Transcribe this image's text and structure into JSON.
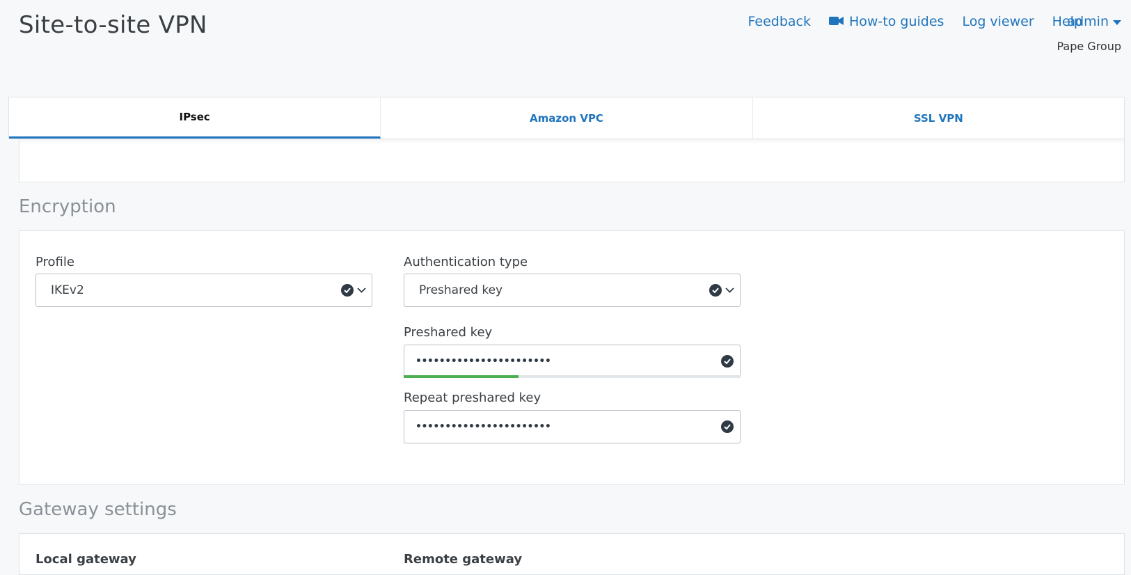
{
  "page": {
    "title": "Site-to-site VPN"
  },
  "header": {
    "nav": [
      {
        "label": "Feedback",
        "icon": ""
      },
      {
        "label": "How-to guides",
        "icon": "video-camera-icon"
      },
      {
        "label": "Log viewer",
        "icon": ""
      },
      {
        "label": "Help",
        "icon": ""
      }
    ],
    "user": "admin",
    "org": "Pape Group"
  },
  "tabs": [
    {
      "label": "IPsec",
      "active": true
    },
    {
      "label": "Amazon VPC",
      "active": false
    },
    {
      "label": "SSL VPN",
      "active": false
    }
  ],
  "encryption": {
    "heading": "Encryption",
    "profile_label": "Profile",
    "profile_value": "IKEv2",
    "auth_type_label": "Authentication type",
    "auth_type_value": "Preshared key",
    "psk_label": "Preshared key",
    "psk_value": "•••••••••••••••••••••••",
    "psk_strength": 0.34,
    "repeat_psk_label": "Repeat preshared key",
    "repeat_psk_value": "•••••••••••••••••••••••"
  },
  "gateway": {
    "heading": "Gateway settings",
    "local_label": "Local gateway",
    "remote_label": "Remote gateway"
  },
  "colors": {
    "link": "#1f75bd",
    "strength": "#4caf50"
  }
}
